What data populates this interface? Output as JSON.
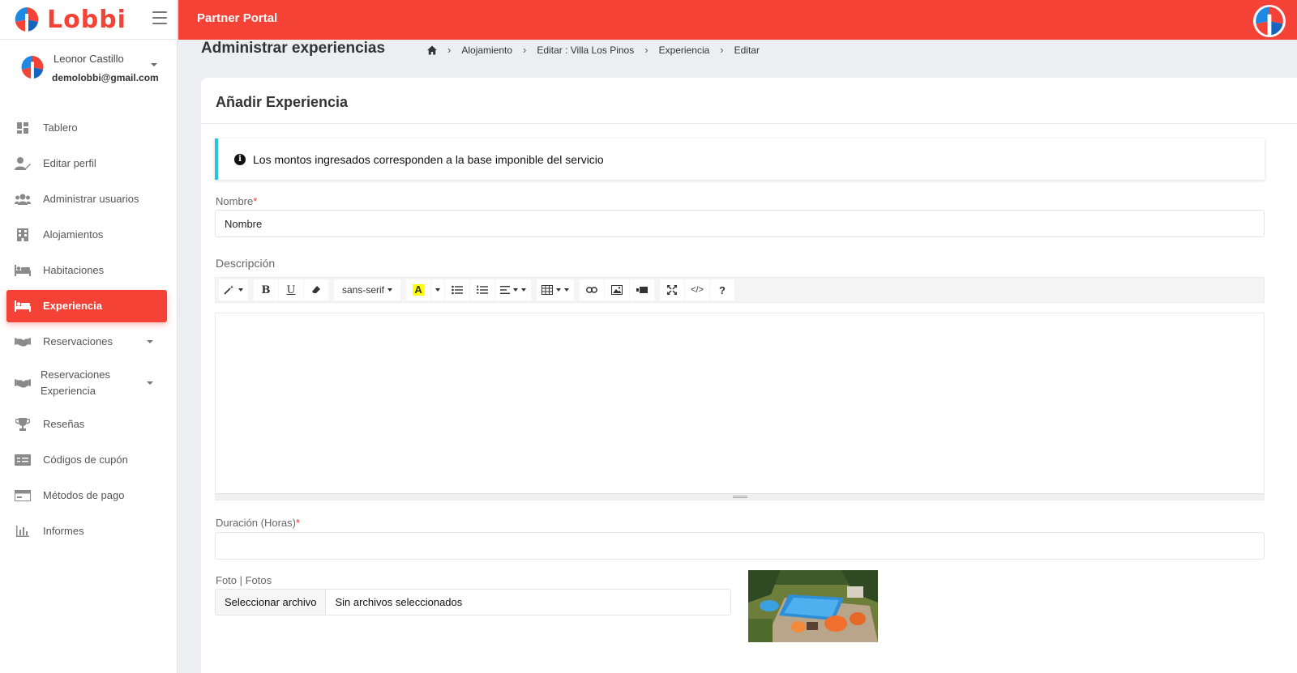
{
  "brand": {
    "name": "Lobbi",
    "accent": "#f44336"
  },
  "user": {
    "name": "Leonor Castillo",
    "email": "demolobbi@gmail.com"
  },
  "sidebar": {
    "items": [
      {
        "label": "Tablero",
        "icon": "dashboard-icon"
      },
      {
        "label": "Editar perfil",
        "icon": "user-edit-icon"
      },
      {
        "label": "Administrar usuarios",
        "icon": "users-icon"
      },
      {
        "label": "Alojamientos",
        "icon": "building-icon"
      },
      {
        "label": "Habitaciones",
        "icon": "bed-icon"
      },
      {
        "label": "Experiencia",
        "icon": "bed-icon",
        "active": true
      },
      {
        "label": "Reservaciones",
        "icon": "handshake-icon",
        "has_submenu": true
      },
      {
        "label": "Reservaciones Experiencia",
        "icon": "handshake-icon",
        "has_submenu": true
      },
      {
        "label": "Reseñas",
        "icon": "trophy-icon"
      },
      {
        "label": "Códigos de cupón",
        "icon": "coupon-icon"
      },
      {
        "label": "Métodos de pago",
        "icon": "payment-icon"
      },
      {
        "label": "Informes",
        "icon": "chart-icon"
      }
    ]
  },
  "topbar": {
    "title": "Partner Portal"
  },
  "header": {
    "title": "Administrar experiencias",
    "breadcrumb": [
      "Alojamiento",
      "Editar : Villa Los Pinos",
      "Experiencia",
      "Editar"
    ]
  },
  "card": {
    "title": "Añadir Experiencia"
  },
  "alert": {
    "text": "Los montos ingresados corresponden a la base imponible del servicio",
    "color": "#26c6da"
  },
  "form": {
    "nombre": {
      "label": "Nombre",
      "required_mark": "*",
      "placeholder": "Nombre"
    },
    "descripcion": {
      "label": "Descripción"
    },
    "duracion": {
      "label": "Duración (Horas)",
      "required_mark": "*",
      "value": ""
    },
    "fotos": {
      "label": "Foto | Fotos",
      "button": "Seleccionar archivo",
      "status": "Sin archivos seleccionados"
    }
  },
  "editor": {
    "font": "sans-serif"
  }
}
